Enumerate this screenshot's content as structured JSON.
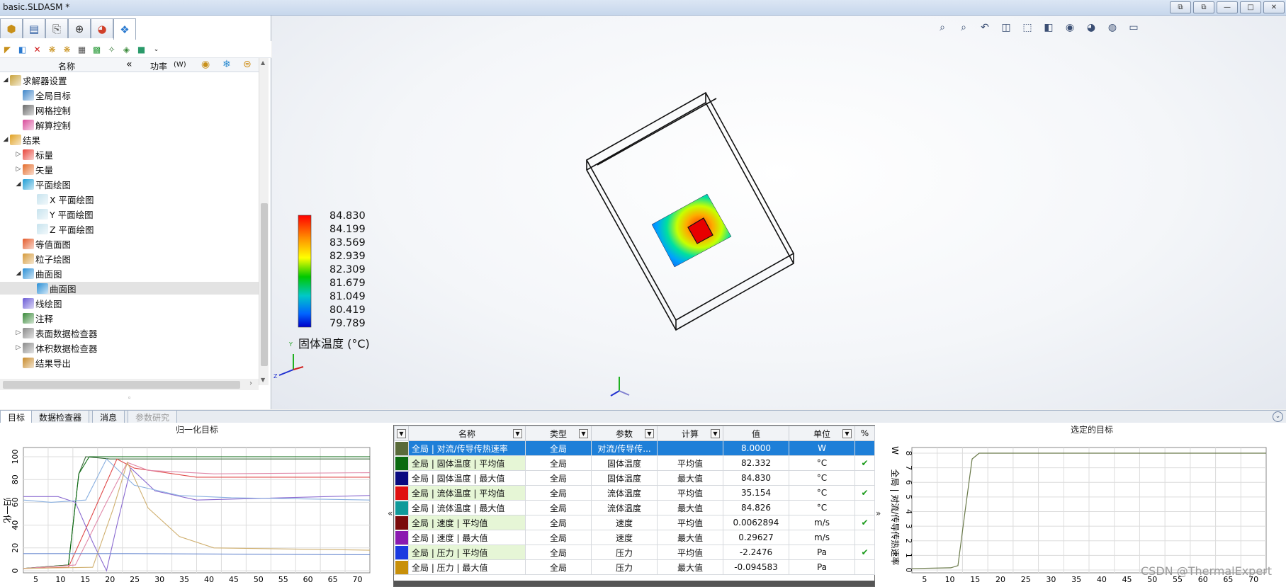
{
  "window": {
    "title": "basic.SLDASM *",
    "buttons": [
      "⧉",
      "⧉",
      "—",
      "□",
      "✕"
    ]
  },
  "left_panel": {
    "header": {
      "name": "名称",
      "collapse": "«",
      "power": "功率",
      "unit": "(W)"
    },
    "tree": [
      {
        "label": "求解器设置",
        "level": 0,
        "exp": "◢",
        "color": "#c8a23a"
      },
      {
        "label": "全局目标",
        "level": 1,
        "exp": "",
        "color": "#3f86c9"
      },
      {
        "label": "网格控制",
        "level": 1,
        "exp": "",
        "color": "#6a6a6a"
      },
      {
        "label": "解算控制",
        "level": 1,
        "exp": "",
        "color": "#d84b9a"
      },
      {
        "label": "结果",
        "level": 0,
        "exp": "◢",
        "color": "#e0a020"
      },
      {
        "label": "标量",
        "level": 1,
        "exp": "▷",
        "color": "#e8443a"
      },
      {
        "label": "矢量",
        "level": 1,
        "exp": "▷",
        "color": "#e46b2a"
      },
      {
        "label": "平面绘图",
        "level": 1,
        "exp": "◢",
        "color": "#1f9ed6"
      },
      {
        "label": "X  平面绘图",
        "level": 2,
        "exp": "",
        "color": "#c7e3ee"
      },
      {
        "label": "Y  平面绘图",
        "level": 2,
        "exp": "",
        "color": "#c7e3ee"
      },
      {
        "label": "Z  平面绘图",
        "level": 2,
        "exp": "",
        "color": "#c7e3ee"
      },
      {
        "label": "等值面图",
        "level": 1,
        "exp": "",
        "color": "#e45a2a"
      },
      {
        "label": "粒子绘图",
        "level": 1,
        "exp": "",
        "color": "#d69a3a"
      },
      {
        "label": "曲面图",
        "level": 1,
        "exp": "◢",
        "color": "#2a8fd6"
      },
      {
        "label": "曲面图",
        "level": 2,
        "exp": "",
        "color": "#2a8fd6",
        "selected": true
      },
      {
        "label": "线绘图",
        "level": 1,
        "exp": "",
        "color": "#6a5ad6"
      },
      {
        "label": "注释",
        "level": 1,
        "exp": "",
        "color": "#3a8a3a"
      },
      {
        "label": "表面数据检查器",
        "level": 1,
        "exp": "▷",
        "color": "#8a8a8a"
      },
      {
        "label": "体积数据检查器",
        "level": 1,
        "exp": "▷",
        "color": "#8a8a8a"
      },
      {
        "label": "结果导出",
        "level": 1,
        "exp": "",
        "color": "#c88a2a"
      }
    ]
  },
  "legend": {
    "values": [
      "84.830",
      "84.199",
      "83.569",
      "82.939",
      "82.309",
      "81.679",
      "81.049",
      "80.419",
      "79.789"
    ],
    "title": "固体温度 (°C)"
  },
  "bottom_tabs": [
    {
      "label": "目标",
      "state": "active"
    },
    {
      "label": "数据检查器",
      "state": "normal"
    },
    {
      "label": "消息",
      "state": "normal"
    },
    {
      "label": "参数研究",
      "state": "disabled"
    }
  ],
  "left_chart": {
    "title": "归一化目标",
    "ylabel": "归一化",
    "yticks": [
      "100",
      "80",
      "60",
      "40",
      "20",
      "0"
    ],
    "xticks": [
      "5",
      "10",
      "15",
      "20",
      "25",
      "30",
      "35",
      "40",
      "45",
      "50",
      "55",
      "60",
      "65",
      "70"
    ]
  },
  "goals_table": {
    "headers": [
      "名称",
      "类型",
      "参数",
      "计算",
      "值",
      "单位",
      "%"
    ],
    "rows": [
      {
        "name": "全局 | 对流/传导传热速率",
        "type": "全局",
        "param": "对流/传导传...",
        "calc": "",
        "value": "8.0000",
        "unit": "W",
        "check": "",
        "color": "#5a6b3a",
        "selected": true
      },
      {
        "name": "全局 | 固体温度 | 平均值",
        "type": "全局",
        "param": "固体温度",
        "calc": "平均值",
        "value": "82.332",
        "unit": "°C",
        "check": "✔",
        "color": "#0a6a10"
      },
      {
        "name": "全局 | 固体温度 | 最大值",
        "type": "全局",
        "param": "固体温度",
        "calc": "最大值",
        "value": "84.830",
        "unit": "°C",
        "check": "",
        "color": "#0a0a80"
      },
      {
        "name": "全局 | 流体温度 | 平均值",
        "type": "全局",
        "param": "流体温度",
        "calc": "平均值",
        "value": "35.154",
        "unit": "°C",
        "check": "✔",
        "color": "#e01010"
      },
      {
        "name": "全局 | 流体温度 | 最大值",
        "type": "全局",
        "param": "流体温度",
        "calc": "最大值",
        "value": "84.826",
        "unit": "°C",
        "check": "",
        "color": "#109a9a"
      },
      {
        "name": "全局 | 速度 | 平均值",
        "type": "全局",
        "param": "速度",
        "calc": "平均值",
        "value": "0.0062894",
        "unit": "m/s",
        "check": "✔",
        "color": "#7a0a0a"
      },
      {
        "name": "全局 | 速度 | 最大值",
        "type": "全局",
        "param": "速度",
        "calc": "最大值",
        "value": "0.29627",
        "unit": "m/s",
        "check": "",
        "color": "#8a1ab0"
      },
      {
        "name": "全局 | 压力 | 平均值",
        "type": "全局",
        "param": "压力",
        "calc": "平均值",
        "value": "-2.2476",
        "unit": "Pa",
        "check": "✔",
        "color": "#1a3ae0"
      },
      {
        "name": "全局 | 压力 | 最大值",
        "type": "全局",
        "param": "压力",
        "calc": "最大值",
        "value": "-0.094583",
        "unit": "Pa",
        "check": "",
        "color": "#c8900a"
      }
    ]
  },
  "right_chart": {
    "title": "选定的目标",
    "unit_label": "W",
    "ylabel": "全局 | 对流/传导传热速率",
    "yticks": [
      "8",
      "7",
      "6",
      "5",
      "4",
      "3",
      "2",
      "1",
      "0"
    ],
    "xticks": [
      "5",
      "10",
      "15",
      "20",
      "25",
      "30",
      "35",
      "40",
      "45",
      "50",
      "55",
      "60",
      "65",
      "70"
    ]
  },
  "watermark": "CSDN @ThermalExpert"
}
